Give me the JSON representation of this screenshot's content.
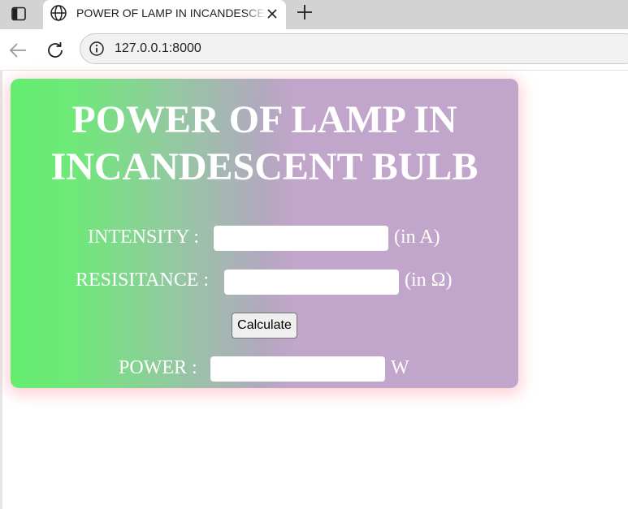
{
  "browser": {
    "tab_title": "POWER OF LAMP IN INCANDESCENT BULB",
    "url": "127.0.0.1:8000"
  },
  "calculator": {
    "title": "POWER OF LAMP IN INCANDESCENT BULB",
    "intensity_label": "INTENSITY :",
    "intensity_unit": "(in A)",
    "intensity_value": "",
    "resistance_label": "RESISITANCE :",
    "resistance_unit": "(in Ω)",
    "resistance_value": "",
    "calculate_label": "Calculate",
    "power_label": "POWER :",
    "power_unit": "W",
    "power_value": ""
  },
  "colors": {
    "gradient_start": "#64ee70",
    "gradient_end": "#c2a5cb",
    "card_shadow": "#ff96a0",
    "text": "#ffffff"
  },
  "icons": [
    "sidebar-icon",
    "globe-icon",
    "close-icon",
    "plus-icon",
    "back-arrow-icon",
    "reload-icon",
    "info-icon"
  ]
}
